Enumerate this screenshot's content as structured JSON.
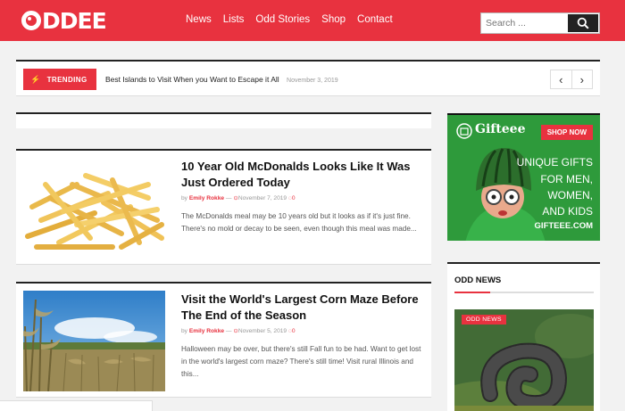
{
  "header": {
    "logo_text": "DDEE",
    "nav": [
      "News",
      "Lists",
      "Odd Stories",
      "Shop",
      "Contact"
    ],
    "search_placeholder": "Search ...",
    "brand_color": "#e8323f"
  },
  "trending": {
    "label": "TRENDING",
    "headline": "Best Islands to Visit When you Want to Escape it All",
    "date": "November 3, 2019",
    "prev_icon": "chevron-left-icon",
    "next_icon": "chevron-right-icon"
  },
  "posts": [
    {
      "title": "10 Year Old McDonalds Looks Like It Was Just Ordered Today",
      "by": "by",
      "author": "Emily Rokke",
      "date": "November 7, 2019",
      "comments": "0",
      "excerpt": "The McDonalds meal may be 10 years old but it looks as if it's just fine. There's no mold or decay to be seen, even though this meal was made..."
    },
    {
      "title": "Visit the World's Largest Corn Maze Before The End of the Season",
      "by": "by",
      "author": "Emily Rokke",
      "date": "November 5, 2019",
      "comments": "0",
      "excerpt": "Halloween may be over, but there's still Fall fun to be had. Want to get lost in the world's largest corn maze? There's still time! Visit rural Illinois and this..."
    }
  ],
  "ad": {
    "brand": "Gifteee",
    "shop_label": "SHOP NOW",
    "lines": [
      "UNIQUE GIFTS",
      "FOR MEN,",
      "WOMEN,",
      "AND KIDS"
    ],
    "url": "GIFTEEE.COM"
  },
  "sidebar": {
    "section_title": "ODD NEWS",
    "badge": "ODD NEWS"
  }
}
